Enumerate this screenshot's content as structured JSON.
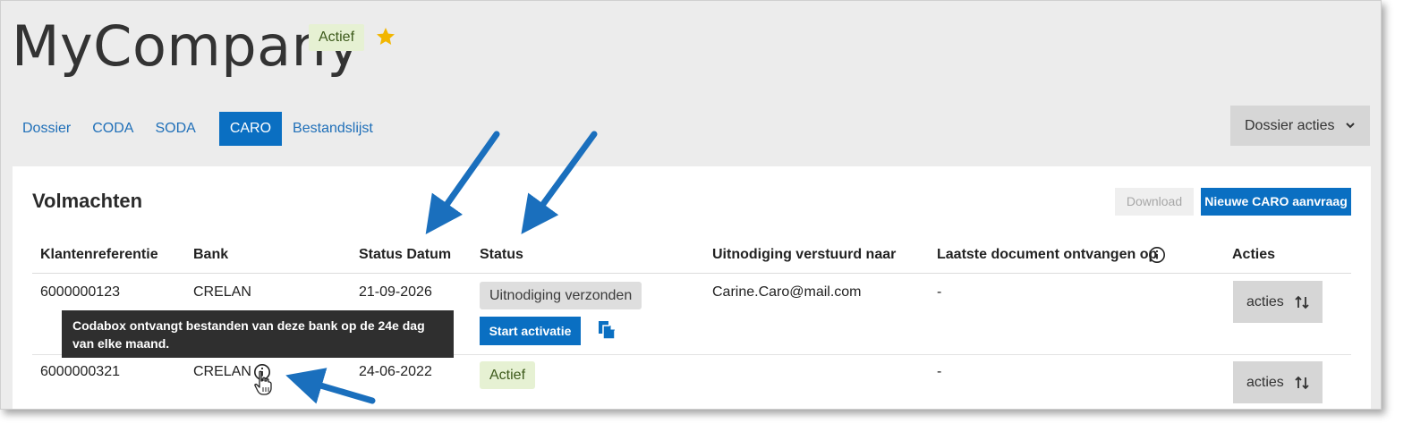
{
  "header": {
    "company": "MyCompany",
    "status_badge": "Actief",
    "favorite_icon": "star-icon",
    "favorite_color": "#f2b600"
  },
  "tabs": [
    {
      "label": "Dossier",
      "active": false
    },
    {
      "label": "CODA",
      "active": false
    },
    {
      "label": "SODA",
      "active": false
    },
    {
      "label": "CARO",
      "active": true
    },
    {
      "label": "Bestandslijst",
      "active": false
    }
  ],
  "dossier_actions": {
    "label": "Dossier acties",
    "icon": "chevron-down-icon"
  },
  "panel": {
    "title": "Volmachten",
    "download_label": "Download",
    "new_request_label": "Nieuwe CARO aanvraag"
  },
  "table": {
    "columns": {
      "client_ref": "Klantenreferentie",
      "bank": "Bank",
      "status_date": "Status Datum",
      "status": "Status",
      "invitation_sent_to": "Uitnodiging verstuurd naar",
      "last_document": "Laatste document ontvangen op",
      "actions": "Acties"
    },
    "rows": [
      {
        "client_ref": "6000000123",
        "bank": "CRELAN",
        "status_date": "21-09-2026",
        "status": "Uitnodiging verzonden",
        "invitation_sent_to": "Carine.Caro@mail.com",
        "last_document": "-",
        "start_label": "Start activatie",
        "actions_label": "acties"
      },
      {
        "client_ref": "6000000321",
        "bank": "CRELAN",
        "status_date": "24-06-2022",
        "status": "Actief",
        "invitation_sent_to": "",
        "last_document": "-",
        "actions_label": "acties"
      }
    ]
  },
  "tooltip": {
    "text": "Codabox ontvangt bestanden van deze bank op de 24e dag van elke maand."
  },
  "colors": {
    "primary": "#0a6fc2",
    "annotation_arrow": "#1a6fbd",
    "active_badge_bg": "#e6f1d3"
  }
}
